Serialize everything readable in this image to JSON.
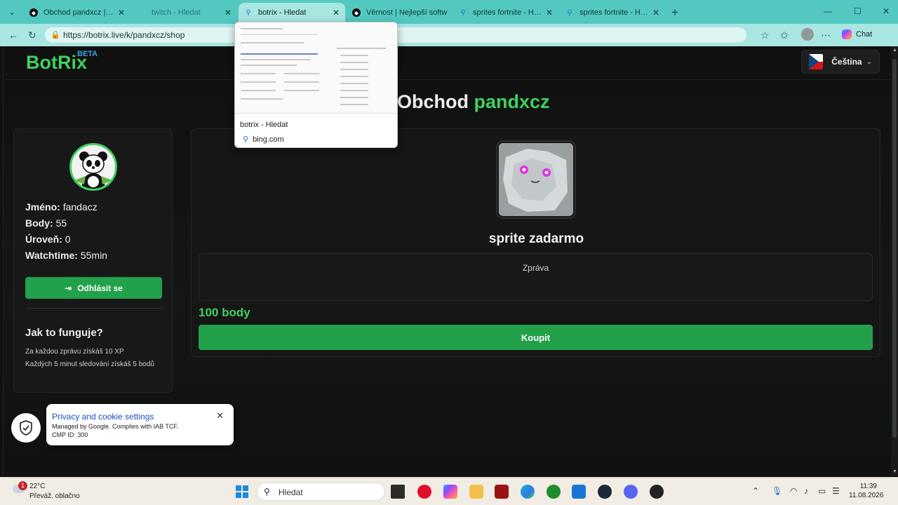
{
  "browser": {
    "tabs": [
      {
        "title": "Obchod pandxcz | Nejle",
        "icon": "botrix-icon",
        "active": false
      },
      {
        "title": "twitch - Hledat",
        "icon": "bing-search-icon",
        "active": false
      },
      {
        "title": "botrix - Hledat",
        "icon": "bing-search-icon",
        "active": true
      },
      {
        "title": "Věrnost | Nejlepší softw",
        "icon": "botrix-icon",
        "active": false
      },
      {
        "title": "sprites fortnite - Hledat",
        "icon": "bing-search-icon",
        "active": false
      },
      {
        "title": "sprites fortnite - Hledat",
        "icon": "bing-search-icon",
        "active": false
      }
    ],
    "url": "https://botrix.live/k/pandxcz/shop",
    "chat_label": "Chat"
  },
  "tab_preview": {
    "title": "botrix - Hledat",
    "domain": "bing.com"
  },
  "site": {
    "logo": "BotRix",
    "beta": "BETA",
    "language": "Čeština"
  },
  "title": {
    "prefix": "Obchod",
    "channel": "pandxcz"
  },
  "profile": {
    "name_label": "Jméno:",
    "name": "fandacz",
    "points_label": "Body:",
    "points": "55",
    "level_label": "Úroveň:",
    "level": "0",
    "watchtime_label": "Watchtime:",
    "watchtime": "55min",
    "logout_label": "Odhlásit se"
  },
  "how": {
    "title": "Jak to funguje?",
    "lines": [
      "Za každou zprávu získáš 10 XP",
      "Každých 5 minut sledování získáš 5 bodů"
    ]
  },
  "item": {
    "name": "sprite zadarmo",
    "message_placeholder": "Zpráva",
    "price": "100 body",
    "buy_label": "Koupit"
  },
  "cookie": {
    "title": "Privacy and cookie settings",
    "line1": "Managed by Google. Complies with IAB TCF.",
    "line2": "CMP ID: 300"
  },
  "taskbar": {
    "weather_badge": "1",
    "temperature": "22°C",
    "condition": "Převáž. oblačno",
    "search_placeholder": "Hledat",
    "time": "11:39",
    "date": "11.08.2026"
  },
  "colors": {
    "accent_green": "#3fd15e",
    "button_green": "#23a04a",
    "tab_strip": "#52c8c0"
  }
}
